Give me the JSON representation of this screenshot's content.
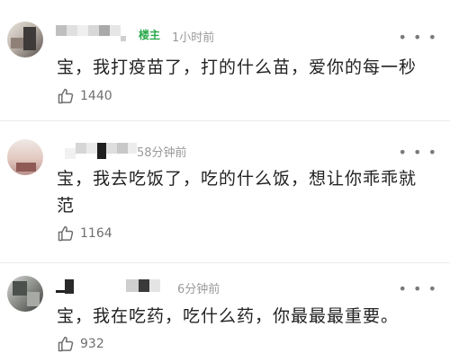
{
  "comments": [
    {
      "badge": "楼主",
      "time": "1小时前",
      "content": "宝，我打疫苗了，打的什么苗，爱你的每一秒",
      "likes": "1440",
      "more": "• • •"
    },
    {
      "time": "58分钟前",
      "content": "宝，我去吃饭了，吃的什么饭，想让你乖乖就范",
      "likes": "1164",
      "more": "• • •"
    },
    {
      "time": "6分钟前",
      "content": "宝，我在吃药，吃什么药，你最最最重要。",
      "likes": "932",
      "more": "• • •"
    }
  ],
  "colors": {
    "badge": "#2aa84a",
    "meta": "#9a9a9a",
    "text": "#222222"
  }
}
